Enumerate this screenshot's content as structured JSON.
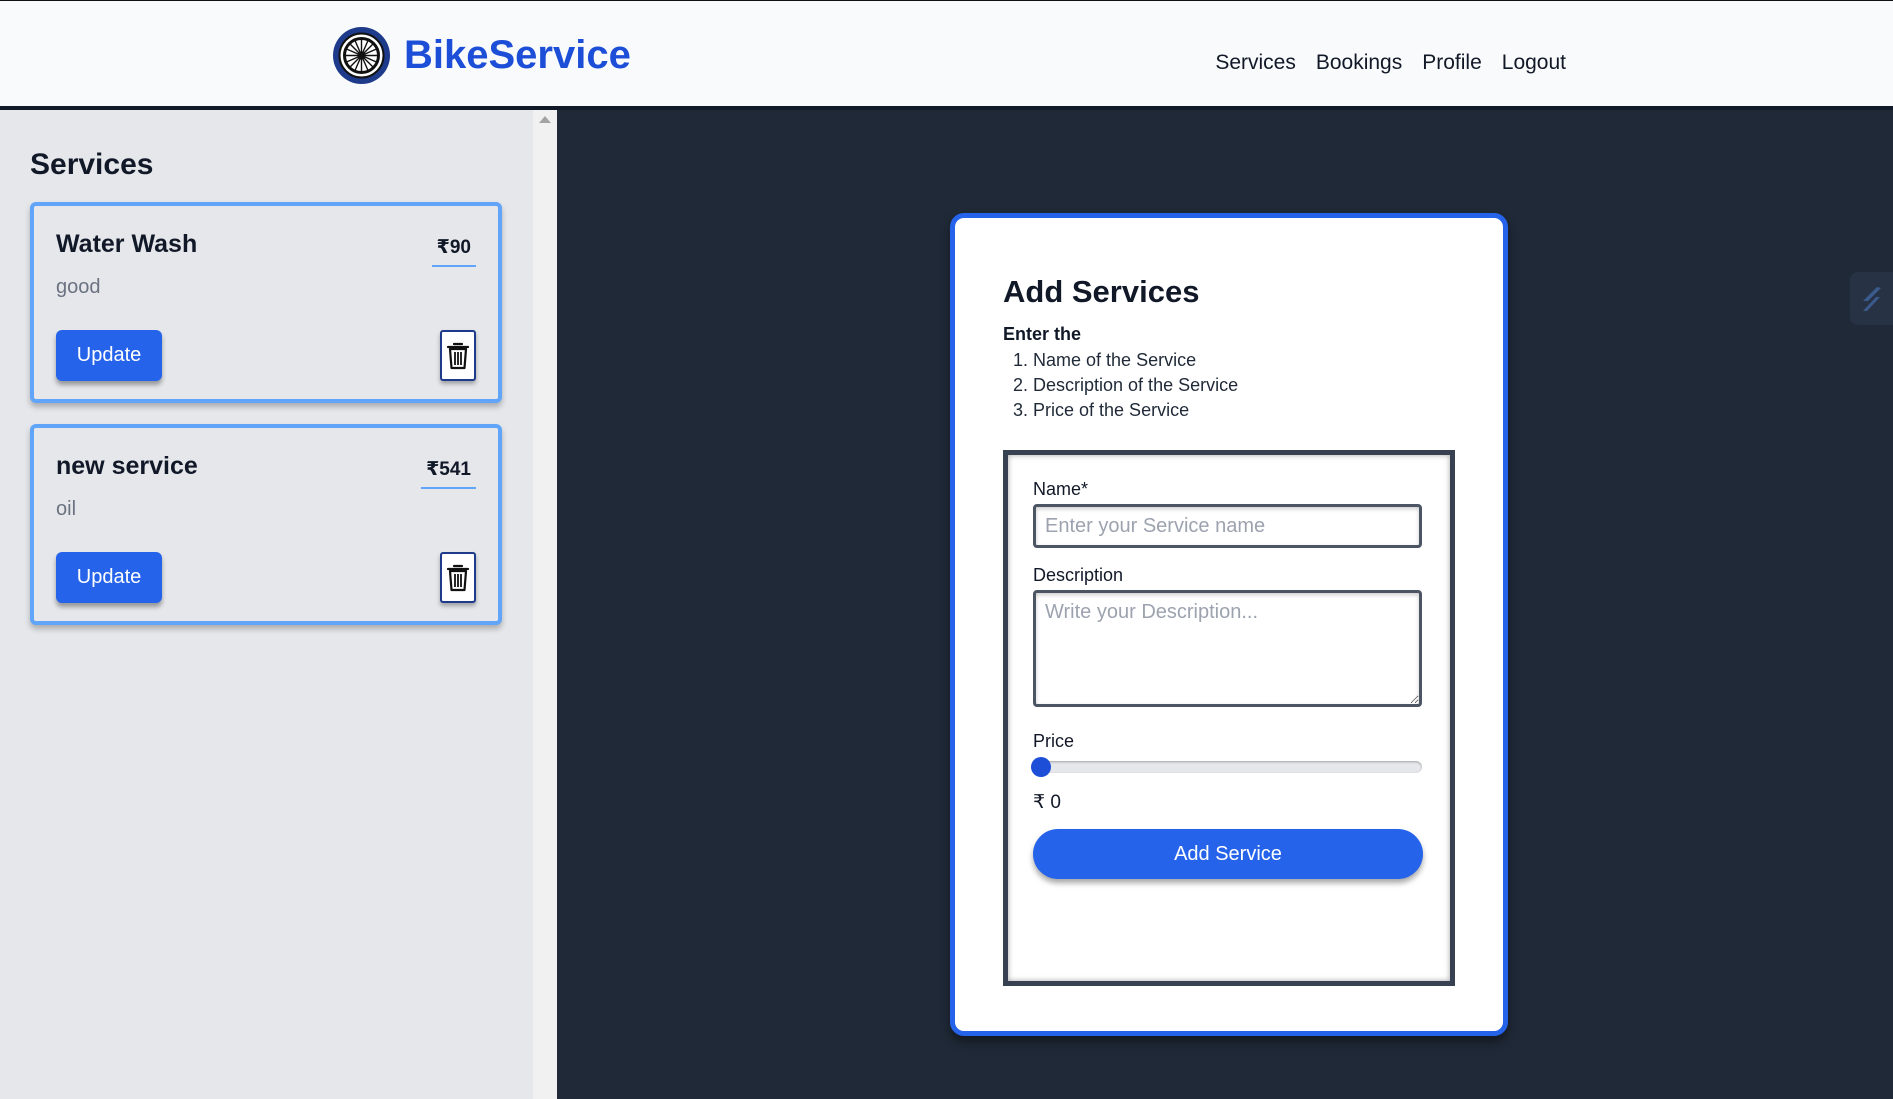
{
  "header": {
    "brand": "BikeService",
    "nav": [
      "Services",
      "Bookings",
      "Profile",
      "Logout"
    ]
  },
  "sidebar": {
    "title": "Services",
    "cards": [
      {
        "name": "Water Wash",
        "price": "₹90",
        "description": "good",
        "update_label": "Update"
      },
      {
        "name": "new service",
        "price": "₹541",
        "description": "oil",
        "update_label": "Update"
      }
    ]
  },
  "form": {
    "title": "Add Services",
    "instructions_head": "Enter the",
    "instructions": [
      "1. Name of the Service",
      "2. Description of the Service",
      "3. Price of the Service"
    ],
    "name_label": "Name*",
    "name_placeholder": "Enter your Service name",
    "name_value": "",
    "description_label": "Description",
    "description_placeholder": "Write your Description...",
    "price_label": "Price",
    "price_value": 0,
    "price_display": "₹ 0",
    "submit_label": "Add Service"
  },
  "colors": {
    "accent": "#2563eb",
    "brand": "#1d4ed8",
    "dark_bg": "#1f2937",
    "sidebar_bg": "#e5e7eb",
    "card_border": "#60a5fa"
  },
  "icons": {
    "logo": "wheel-icon",
    "delete": "trash-icon",
    "scroll_up": "triangle-up-icon",
    "widget": "slash-logo-icon"
  }
}
